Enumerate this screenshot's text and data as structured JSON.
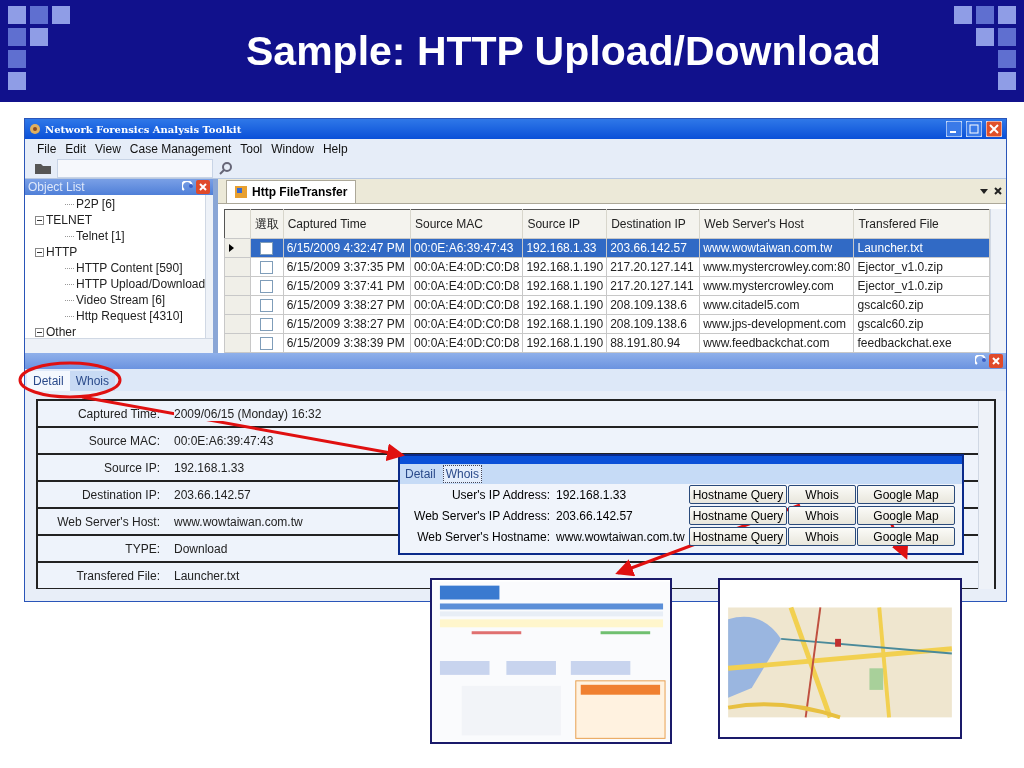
{
  "slide_title": "Sample: HTTP Upload/Download",
  "window": {
    "title": "Network Forensics Analysis Toolkit"
  },
  "menu": [
    "File",
    "Edit",
    "View",
    "Case Management",
    "Tool",
    "Window",
    "Help"
  ],
  "object_list": {
    "title": "Object List",
    "tree": [
      {
        "children": [
          {
            "label": "P2P [6]"
          }
        ]
      },
      {
        "label": "TELNET",
        "expanded": true,
        "children": [
          {
            "label": "Telnet [1]"
          }
        ]
      },
      {
        "label": "HTTP",
        "expanded": true,
        "children": [
          {
            "label": "HTTP Content [590]"
          },
          {
            "label": "HTTP Upload/Download"
          },
          {
            "label": "Video Stream [6]"
          },
          {
            "label": "Http Request [4310]"
          }
        ]
      },
      {
        "label": "Other",
        "expanded": true
      }
    ]
  },
  "document_tab": {
    "title": "Http FileTransfer"
  },
  "table": {
    "checkbox_column": "選取",
    "columns": [
      "Captured Time",
      "Source MAC",
      "Source IP",
      "Destination IP",
      "Web Server's Host",
      "Transfered File"
    ],
    "rows": [
      {
        "selected": true,
        "checked": false,
        "cells": [
          "6/15/2009 4:32:47 PM",
          "00:0E:A6:39:47:43",
          "192.168.1.33",
          "203.66.142.57",
          "www.wowtaiwan.com.tw",
          "Launcher.txt"
        ]
      },
      {
        "selected": false,
        "checked": false,
        "cells": [
          "6/15/2009 3:37:35 PM",
          "00:0A:E4:0D:C0:D8",
          "192.168.1.190",
          "217.20.127.141",
          "www.mystercrowley.com:80",
          "Ejector_v1.0.zip"
        ]
      },
      {
        "selected": false,
        "checked": false,
        "cells": [
          "6/15/2009 3:37:41 PM",
          "00:0A:E4:0D:C0:D8",
          "192.168.1.190",
          "217.20.127.141",
          "www.mystercrowley.com",
          "Ejector_v1.0.zip"
        ]
      },
      {
        "selected": false,
        "checked": false,
        "cells": [
          "6/15/2009 3:38:27 PM",
          "00:0A:E4:0D:C0:D8",
          "192.168.1.190",
          "208.109.138.6",
          "www.citadel5.com",
          "gscalc60.zip"
        ]
      },
      {
        "selected": false,
        "checked": false,
        "cells": [
          "6/15/2009 3:38:27 PM",
          "00:0A:E4:0D:C0:D8",
          "192.168.1.190",
          "208.109.138.6",
          "www.jps-development.com",
          "gscalc60.zip"
        ]
      },
      {
        "selected": false,
        "checked": false,
        "cells": [
          "6/15/2009 3:38:39 PM",
          "00:0A:E4:0D:C0:D8",
          "192.168.1.190",
          "88.191.80.94",
          "www.feedbackchat.com",
          "feedbackchat.exe"
        ]
      }
    ]
  },
  "detail_tabs": [
    {
      "label": "Detail",
      "selected": true
    },
    {
      "label": "Whois",
      "selected": false
    }
  ],
  "detail_fields": [
    {
      "label": "Captured Time:",
      "value": "2009/06/15 (Monday) 16:32"
    },
    {
      "label": "Source MAC:",
      "value": "00:0E:A6:39:47:43"
    },
    {
      "label": "Source IP:",
      "value": "192.168.1.33"
    },
    {
      "label": "Destination IP:",
      "value": "203.66.142.57"
    },
    {
      "label": "Web Server's Host:",
      "value": "www.wowtaiwan.com.tw"
    },
    {
      "label": "TYPE:",
      "value": "Download"
    },
    {
      "label": "Transfered File:",
      "value": "Launcher.txt"
    }
  ],
  "whois_dialog": {
    "tabs": [
      {
        "label": "Detail",
        "selected": false
      },
      {
        "label": "Whois",
        "selected": true
      }
    ],
    "rows": [
      {
        "label": "User's IP Address:",
        "value": "192.168.1.33",
        "buttons": [
          "Hostname Query",
          "Whois",
          "Google Map"
        ]
      },
      {
        "label": "Web Server's IP Address:",
        "value": "203.66.142.57",
        "buttons": [
          "Hostname Query",
          "Whois",
          "Google Map"
        ]
      },
      {
        "label": "Web Server's Hostname:",
        "value": "www.wowtaiwan.com.tw",
        "buttons": [
          "Hostname Query",
          "Whois",
          "Google Map"
        ]
      }
    ]
  }
}
